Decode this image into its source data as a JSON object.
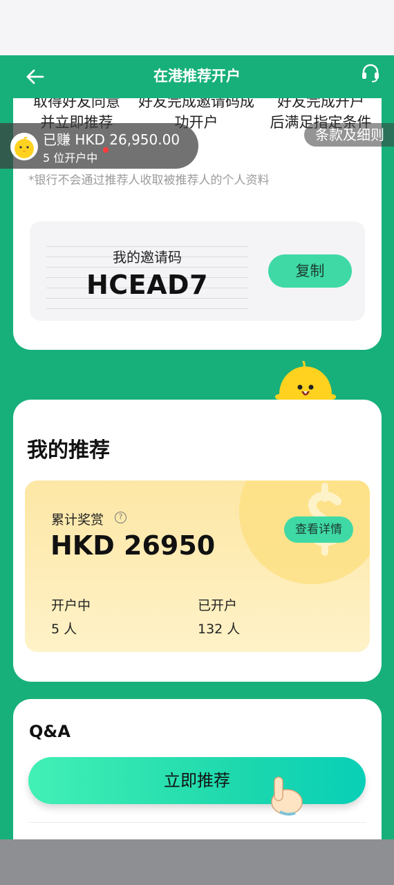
{
  "header": {
    "title": "在港推荐开户"
  },
  "steps": [
    {
      "line1": "取得好友同意",
      "line2": "并立即推荐"
    },
    {
      "line1": "好友完成邀请码成",
      "line2": "功开户"
    },
    {
      "line1": "好友完成开户",
      "line2": "后满足指定条件"
    }
  ],
  "disclaimer": "*银行不会通过推荐人收取被推荐人的个人资料",
  "invite": {
    "label": "我的邀请码",
    "code": "HCEAD7",
    "copy_label": "复制"
  },
  "toast": {
    "amount": "已赚 HKD 26,950.00",
    "count": "5 位开户中"
  },
  "terms": {
    "label": "条款及细则"
  },
  "my_referrals": {
    "title": "我的推荐",
    "reward_label": "累计奖赏",
    "reward_amount": "HKD 26950",
    "details_label": "查看详情",
    "pending_label": "开户中",
    "pending_value": "5 人",
    "opened_label": "已开户",
    "opened_value": "132 人"
  },
  "qa": {
    "title": "Q&A",
    "button_label": "立即推荐"
  },
  "colors": {
    "brand_green": "#17b07a",
    "accent_mint": "#3fd9a6",
    "reward_yellow": "#fde7a5"
  }
}
